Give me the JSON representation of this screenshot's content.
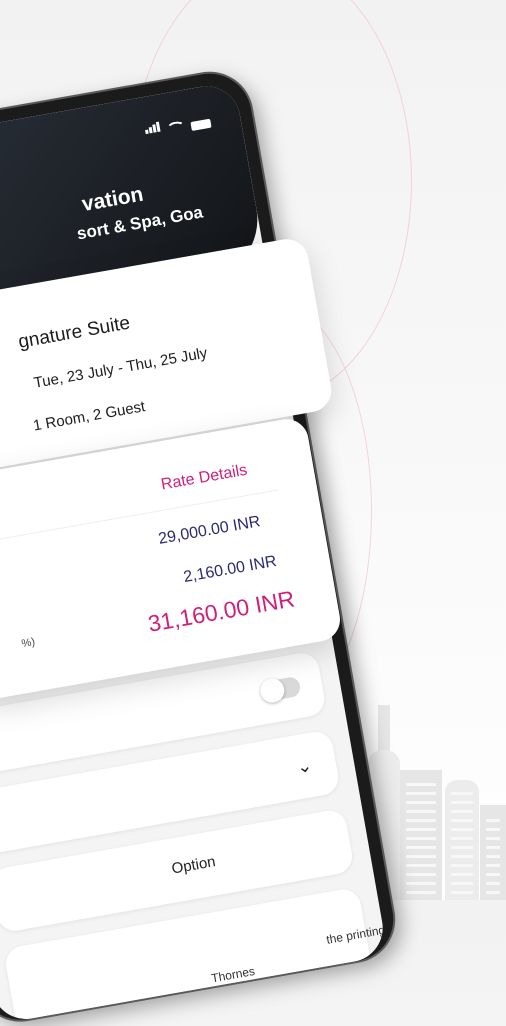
{
  "header": {
    "title": "vation",
    "subtitle": "sort & Spa, Goa"
  },
  "booking": {
    "room": "gnature Suite",
    "dates": "Tue, 23 July  -  Thu, 25 July",
    "guests": "1 Room, 2 Guest"
  },
  "rates": {
    "link": "Rate Details",
    "room_total": "29,000.00 INR",
    "taxes": "2,160.00 INR",
    "tax_note": "%)",
    "grand_total": "31,160.00 INR"
  },
  "options": {
    "option_label": "Option",
    "partial_name": "Thornes",
    "terms_text": "the printing and"
  },
  "colors": {
    "accent": "#d0207a",
    "price_text": "#2a2a6e",
    "header_dark": "#1e2228"
  },
  "icons": [
    "signal-icon",
    "wifi-icon",
    "battery-icon",
    "chevron-down-icon",
    "toggle-switch"
  ]
}
